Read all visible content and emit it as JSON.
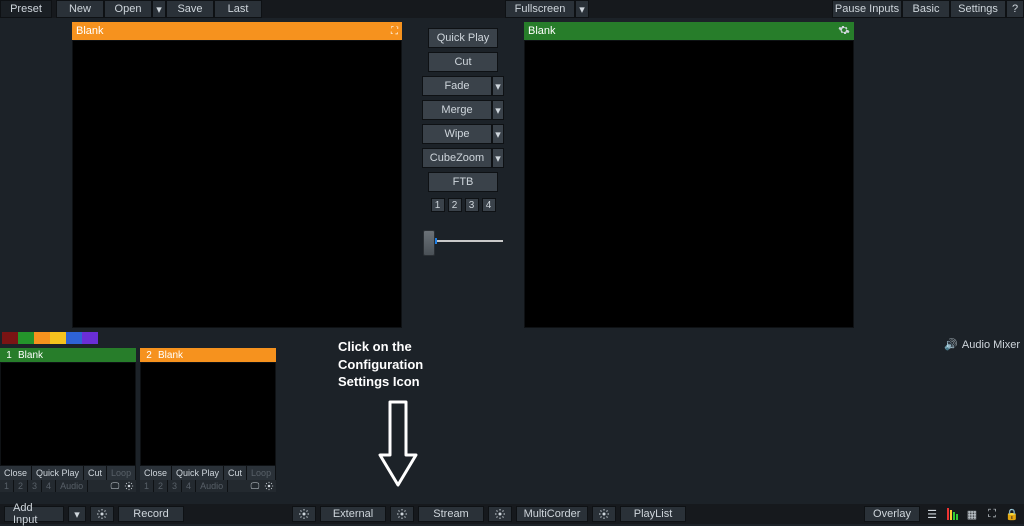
{
  "topbar": {
    "preset": "Preset",
    "new": "New",
    "open": "Open",
    "save": "Save",
    "last": "Last",
    "fullscreen": "Fullscreen",
    "pause_inputs": "Pause Inputs",
    "basic": "Basic",
    "settings": "Settings",
    "help": "?"
  },
  "preview": {
    "title": "Blank"
  },
  "output": {
    "title": "Blank"
  },
  "transitions": {
    "quickplay": "Quick Play",
    "cut": "Cut",
    "fade": "Fade",
    "merge": "Merge",
    "wipe": "Wipe",
    "cubezoom": "CubeZoom",
    "ftb": "FTB",
    "nums": [
      "1",
      "2",
      "3",
      "4"
    ]
  },
  "colors": [
    "#7a1414",
    "#24942b",
    "#f6921e",
    "#f6c31e",
    "#2e63d6",
    "#6a2ed6"
  ],
  "inputs": [
    {
      "num": "1",
      "title": "Blank",
      "hdr": "green",
      "ctrl": {
        "close": "Close",
        "quickplay": "Quick Play",
        "cut": "Cut",
        "loop": "Loop"
      },
      "row2": {
        "nums": [
          "1",
          "2",
          "3",
          "4"
        ],
        "audio": "Audio"
      }
    },
    {
      "num": "2",
      "title": "Blank",
      "hdr": "orange",
      "ctrl": {
        "close": "Close",
        "quickplay": "Quick Play",
        "cut": "Cut",
        "loop": "Loop"
      },
      "row2": {
        "nums": [
          "1",
          "2",
          "3",
          "4"
        ],
        "audio": "Audio"
      }
    }
  ],
  "audio_mixer": "Audio Mixer",
  "callout": {
    "l1": "Click on the",
    "l2": "Configuration",
    "l3": "Settings Icon"
  },
  "bottom": {
    "add_input": "Add Input",
    "record": "Record",
    "external": "External",
    "stream": "Stream",
    "multicorder": "MultiCorder",
    "playlist": "PlayList",
    "overlay": "Overlay"
  }
}
